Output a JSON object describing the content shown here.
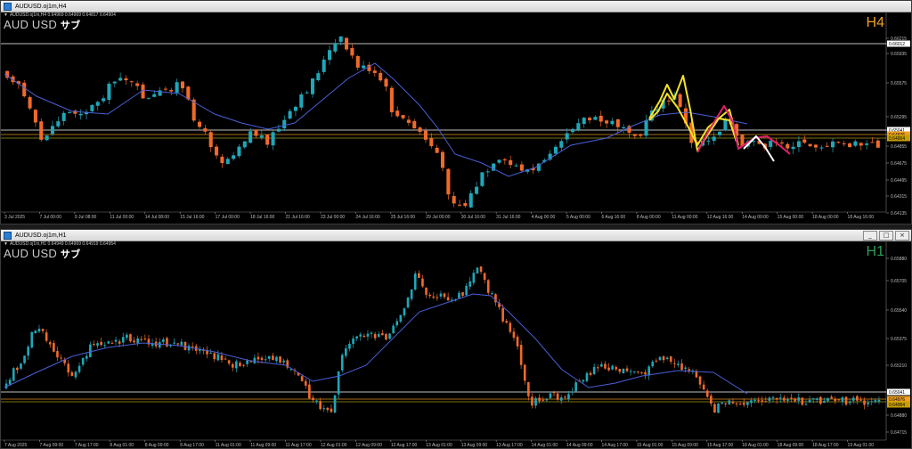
{
  "top": {
    "title": "AUDUSD.oj1m,H4",
    "ohlc": "AUDUSD.oj1m,H4  0.64969 0.64969 0.64817 0.64904",
    "symbol": "AUD USD",
    "sub": "サブ",
    "timeframe": "H4",
    "tf_color": "#f0a020",
    "prices": [
      "0.66215",
      "0.66012",
      "0.65935",
      "0.65575",
      "0.65295",
      "0.65041",
      "0.64976",
      "0.64855",
      "0.64675",
      "0.64495",
      "0.64315",
      "0.64135"
    ],
    "tags": [
      {
        "label": "0.66012",
        "bg": "#ffffff",
        "fg": "#000000"
      },
      {
        "label": "0.65041",
        "bg": "#ffffff",
        "fg": "#000000"
      },
      {
        "label": "0.64976",
        "bg": "#f0a020",
        "fg": "#000000"
      },
      {
        "label": "0.64904",
        "bg": "#c8a000",
        "fg": "#000000"
      }
    ],
    "times": [
      "3 Jul 2025",
      "7 Jul 00:00",
      "9 Jul 08:00",
      "11 Jul 00:00",
      "14 Jul 08:00",
      "15 Jul 16:00",
      "17 Jul 00:00",
      "18 Jul 16:00",
      "21 Jul 16:00",
      "23 Jul 00:00",
      "24 Jul 16:00",
      "25 Jul 16:00",
      "29 Jul 00:00",
      "30 Jul 16:00",
      "31 Jul 16:00",
      "4 Aug 00:00",
      "5 Aug 00:00",
      "6 Aug 16:00",
      "8 Aug 00:00",
      "11 Aug 00:00",
      "12 Aug 16:00",
      "14 Aug 00:00",
      "15 Aug 00:00",
      "18 Aug 00:00",
      "18 Aug 16:00"
    ]
  },
  "bottom": {
    "title": "AUDUSD.oj1m,H1",
    "ohlc": "AUDUSD.oj1m,H1  0.64949 0.64969 0.64919 0.64954",
    "symbol": "AUD USD",
    "sub": "サブ",
    "timeframe": "H1",
    "tf_color": "#2aa05a",
    "prices": [
      "0.65880",
      "0.65705",
      "0.65540",
      "0.65375",
      "0.65210",
      "0.65045",
      "0.64880",
      "0.64715"
    ],
    "tags": [
      {
        "label": "0.65041",
        "bg": "#ffffff",
        "fg": "#000000"
      },
      {
        "label": "0.64976",
        "bg": "#f0a020",
        "fg": "#000000"
      },
      {
        "label": "0.64954",
        "bg": "#c8a000",
        "fg": "#000000"
      }
    ],
    "times": [
      "7 Aug 2025",
      "7 Aug 09:00",
      "7 Aug 17:00",
      "8 Aug 01:00",
      "8 Aug 09:00",
      "8 Aug 17:00",
      "11 Aug 01:00",
      "11 Aug 09:00",
      "11 Aug 17:00",
      "12 Aug 01:00",
      "12 Aug 09:00",
      "12 Aug 17:00",
      "13 Aug 01:00",
      "13 Aug 09:00",
      "13 Aug 17:00",
      "14 Aug 01:00",
      "14 Aug 09:00",
      "14 Aug 17:00",
      "15 Aug 01:00",
      "15 Aug 09:00",
      "15 Aug 17:00",
      "18 Aug 01:00",
      "18 Aug 09:00",
      "18 Aug 17:00",
      "19 Aug 01:00"
    ]
  },
  "colors": {
    "bull": "#1fa7b8",
    "bear": "#f06a2a",
    "ma": "#4a5fd6",
    "grid": "#ffffff",
    "orange": "#e09020",
    "yellow": "#f4e22a",
    "magenta": "#e0206a",
    "white": "#ffffff"
  },
  "window_buttons": [
    "_",
    "□",
    "×"
  ]
}
